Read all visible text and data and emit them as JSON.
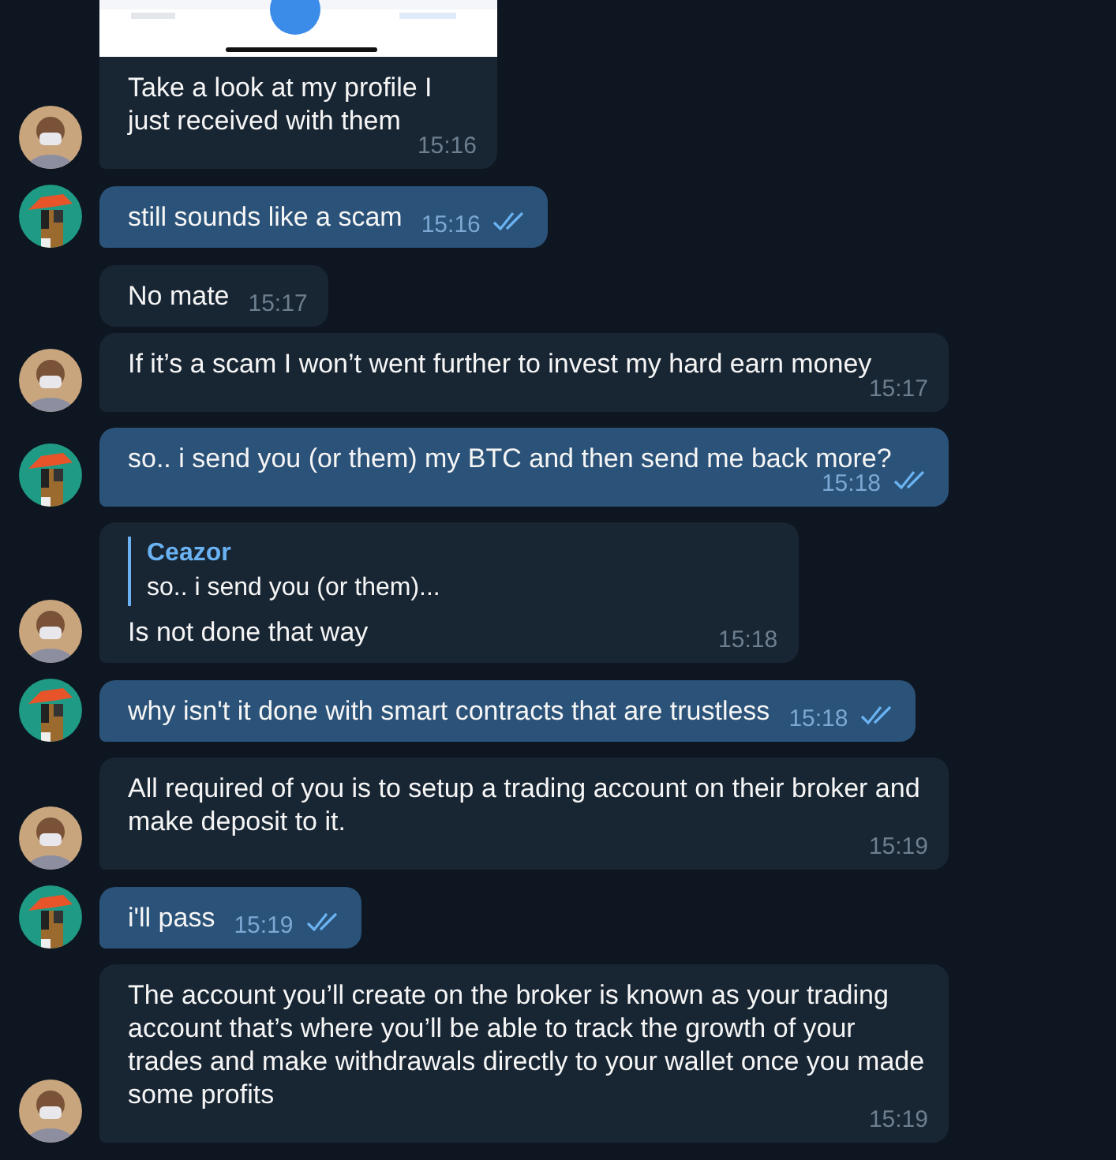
{
  "messages": [
    {
      "kind": "incoming",
      "show_avatar": true,
      "text": "Take a look at my profile I just received with them",
      "time": "15:16"
    },
    {
      "kind": "outgoing",
      "show_avatar": true,
      "text": "still sounds like a scam",
      "time": "15:16",
      "read": true
    },
    {
      "kind": "incoming",
      "show_avatar": false,
      "text": "No mate",
      "time": "15:17"
    },
    {
      "kind": "incoming",
      "show_avatar": true,
      "text": "If it’s a scam I won’t went further to invest my hard earn money",
      "time": "15:17"
    },
    {
      "kind": "outgoing",
      "show_avatar": true,
      "text": "so.. i send you (or them) my BTC and then send me back more?",
      "time": "15:18",
      "read": true
    },
    {
      "kind": "incoming",
      "show_avatar": true,
      "reply": {
        "name": "Ceazor",
        "text": "so.. i send you (or them)..."
      },
      "text": "Is not done that way",
      "time": "15:18"
    },
    {
      "kind": "outgoing",
      "show_avatar": true,
      "text": "why isn't it done with smart contracts that are trustless",
      "time": "15:18",
      "read": true
    },
    {
      "kind": "incoming",
      "show_avatar": true,
      "text": "All required of you is to setup a trading account on their broker and make deposit to it.",
      "time": "15:19"
    },
    {
      "kind": "outgoing",
      "show_avatar": true,
      "text": "i'll pass",
      "time": "15:19",
      "read": true
    },
    {
      "kind": "incoming",
      "show_avatar": true,
      "text": "The account you’ll create on the broker is known as your trading account that’s where you’ll be able to track the growth of your trades and make withdrawals directly to your wallet once you made some profits",
      "time": "15:19"
    }
  ]
}
